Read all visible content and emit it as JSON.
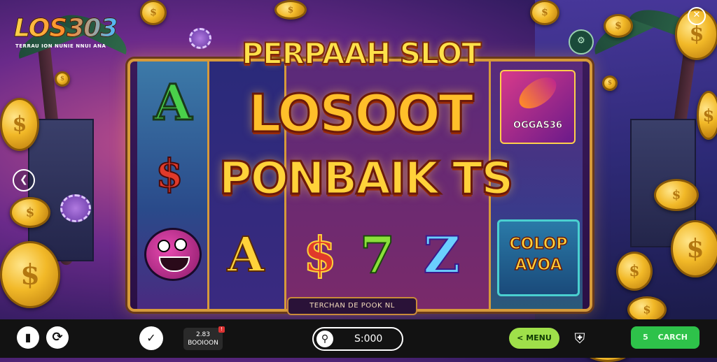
{
  "brand": {
    "logo_text": "LOS303",
    "tagline": "TERRAU ION NUNIE NNUI ANA"
  },
  "game": {
    "title": "PERPAAH SLOT",
    "headline_line1": "LOSOOT",
    "headline_line2": "PONBAIK TS",
    "paytable_label": "TERCHAN DE POOK NL",
    "reel_symbols": {
      "r1_top": "A",
      "r1_mid": "$",
      "r2_bottom": "A",
      "r3_bottom_left": "$",
      "r3_bottom_mid": "7",
      "r3_bottom_right": "Z",
      "r4_top_label": "OGGAS36",
      "r4_bottom": "COLOP AVOA"
    }
  },
  "controls": {
    "bet_value": "2.83",
    "bet_label": "BOOIOON",
    "bet_badge": "!",
    "balance_value": "S:000",
    "balance_icon": "search-icon",
    "menu_label": "< MENU",
    "cart_label": "CARCH",
    "cart_number": "5"
  },
  "colors": {
    "frame": "#d69a3a",
    "title": "#ffe14a",
    "menu_button": "#9fe04a",
    "cart_button": "#2ec24a",
    "bottom_bar": "#121212"
  }
}
